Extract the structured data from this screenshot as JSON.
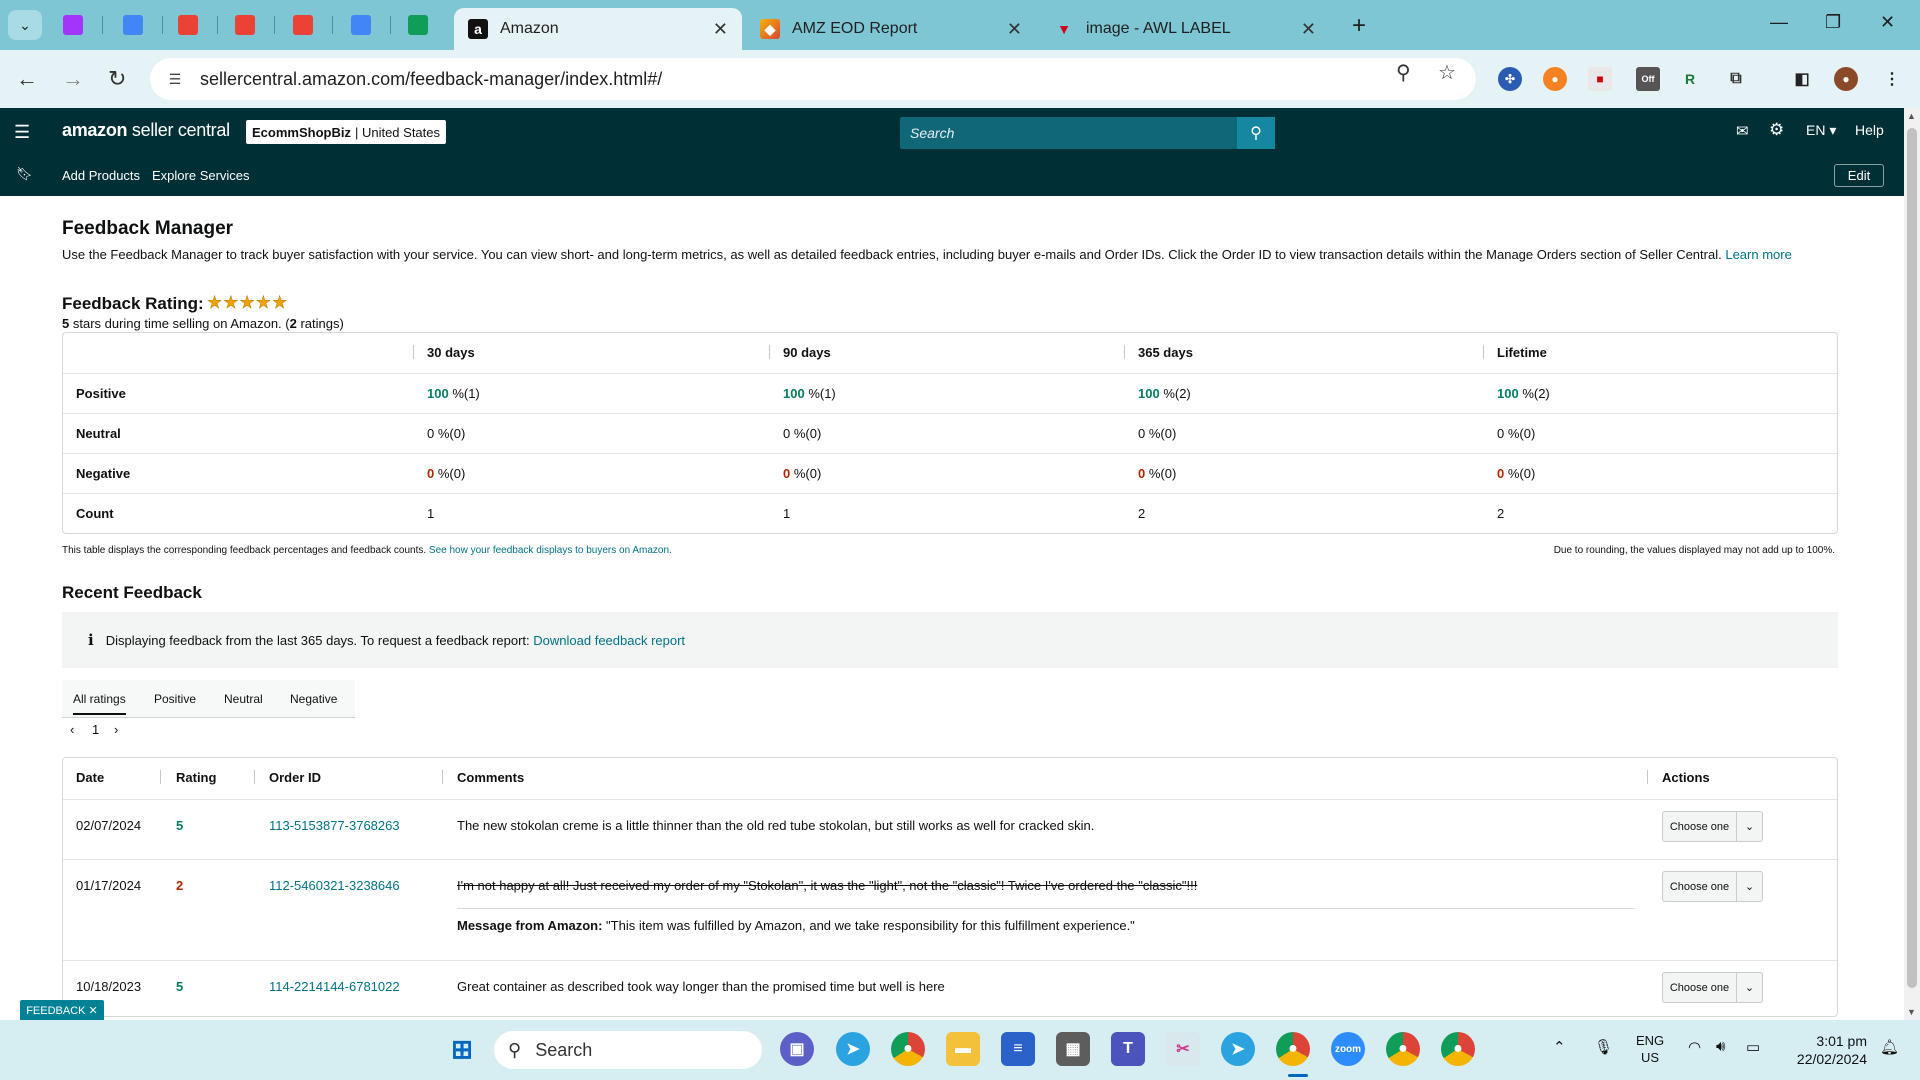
{
  "browser": {
    "pinned_tabs": [
      {
        "name": "messenger",
        "color": "#a334fa"
      },
      {
        "name": "docs",
        "color": "#4285f4"
      },
      {
        "name": "gmail-1",
        "color": "#ea4335"
      },
      {
        "name": "gmail-2",
        "color": "#ea4335"
      },
      {
        "name": "gmail-3",
        "color": "#ea4335"
      },
      {
        "name": "docs-2",
        "color": "#4285f4"
      },
      {
        "name": "sheets",
        "color": "#0f9d58"
      }
    ],
    "tabs": [
      {
        "title": "Amazon",
        "favicon": "a",
        "active": true
      },
      {
        "title": "AMZ EOD Report",
        "favicon": "report"
      },
      {
        "title": "image - AWL LABEL",
        "favicon": "V"
      }
    ],
    "url": "sellercentral.amazon.com/feedback-manager/index.html#/"
  },
  "header": {
    "logo_main": "amazon",
    "logo_sub": "seller central",
    "store_name": "EcommShopBiz",
    "marketplace": "| United States",
    "search_placeholder": "Search",
    "language": "EN",
    "help": "Help"
  },
  "subnav": {
    "links": [
      "Add Products",
      "Explore Services"
    ],
    "edit": "Edit"
  },
  "page": {
    "title": "Feedback Manager",
    "intro": "Use the Feedback Manager to track buyer satisfaction with your service. You can view short- and long-term metrics, as well as detailed feedback entries, including buyer e-mails and Order IDs. Click the Order ID to view transaction details within the Manage Orders section of Seller Central.",
    "learn_more": "Learn more",
    "rating_label": "Feedback Rating:",
    "stars": "★★★★★",
    "rating_sub_stars": "5",
    "rating_sub_text": " stars during time selling on Amazon. (",
    "rating_sub_count": "2",
    "rating_sub_end": " ratings)"
  },
  "metrics": {
    "columns": [
      "30 days",
      "90 days",
      "365 days",
      "Lifetime"
    ],
    "rows": [
      {
        "label": "Positive",
        "values": [
          [
            "100",
            " %(1)"
          ],
          [
            "100",
            " %(1)"
          ],
          [
            "100",
            " %(2)"
          ],
          [
            "100",
            " %(2)"
          ]
        ],
        "style": "green"
      },
      {
        "label": "Neutral",
        "values": [
          [
            "0",
            " %(0)"
          ],
          [
            "0",
            " %(0)"
          ],
          [
            "0",
            " %(0)"
          ],
          [
            "0",
            " %(0)"
          ]
        ],
        "style": "plain"
      },
      {
        "label": "Negative",
        "values": [
          [
            "0",
            " %(0)"
          ],
          [
            "0",
            " %(0)"
          ],
          [
            "0",
            " %(0)"
          ],
          [
            "0",
            " %(0)"
          ]
        ],
        "style": "red"
      },
      {
        "label": "Count",
        "values": [
          [
            "1",
            ""
          ],
          [
            "1",
            ""
          ],
          [
            "2",
            ""
          ],
          [
            "2",
            ""
          ]
        ],
        "style": "plain"
      }
    ],
    "note": "This table displays the corresponding feedback percentages and feedback counts.",
    "note_link": "See how your feedback displays to buyers on Amazon.",
    "note_right": "Due to rounding, the values displayed may not add up to 100%."
  },
  "recent": {
    "title": "Recent Feedback",
    "info": "Displaying feedback from the last 365 days. To request a feedback report:",
    "info_link": "Download feedback report",
    "filter_tabs": [
      "All ratings",
      "Positive",
      "Neutral",
      "Negative"
    ],
    "page": "1",
    "columns": [
      "Date",
      "Rating",
      "Order ID",
      "Comments",
      "Actions"
    ],
    "rows": [
      {
        "date": "02/07/2024",
        "rating": "5",
        "order": "113-5153877-3768263",
        "comment": "The new stokolan creme is a little thinner than the old red tube stokolan, but still works as well for cracked skin.",
        "action": "Choose one"
      },
      {
        "date": "01/17/2024",
        "rating": "2",
        "order": "112-5460321-3238646",
        "comment": "I'm not happy at all! Just received my order of my \"Stokolan\", it was the \"light\", not the \"classic\"! Twice I've ordered the \"classic\"!!!",
        "amazon_label": "Message from Amazon:",
        "amazon_msg": " \"This item was fulfilled by Amazon, and we take responsibility for this fulfillment experience.\"",
        "action": "Choose one"
      },
      {
        "date": "10/18/2023",
        "rating": "5",
        "order": "114-2214144-6781022",
        "comment": "Great container as described took way longer than the promised time but well is here",
        "action": "Choose one"
      }
    ]
  },
  "feedback_tab": "FEEDBACK ✕",
  "taskbar": {
    "search": "Search",
    "lang_1": "ENG",
    "lang_2": "US",
    "time": "3:01 pm",
    "date": "22/02/2024"
  }
}
